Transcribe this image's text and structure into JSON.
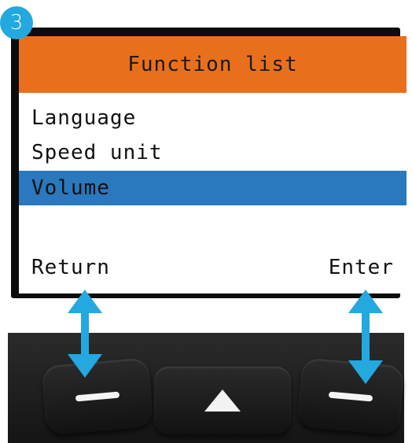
{
  "step": {
    "number": "3"
  },
  "screen": {
    "title": "Function list",
    "menu_items": [
      {
        "label": "Language",
        "selected": false
      },
      {
        "label": "Speed unit",
        "selected": false
      },
      {
        "label": "Volume",
        "selected": true
      }
    ],
    "left_softkey": "Return",
    "right_softkey": "Enter"
  },
  "colors": {
    "title_bar": "#e8701c",
    "selection": "#2a78be",
    "arrows": "#23a8e0",
    "badge": "#23a8e0"
  },
  "icons": {
    "left_button": "dash-icon",
    "middle_button": "up-triangle-icon",
    "right_button": "dash-icon",
    "pointer": "double-arrow-icon"
  }
}
